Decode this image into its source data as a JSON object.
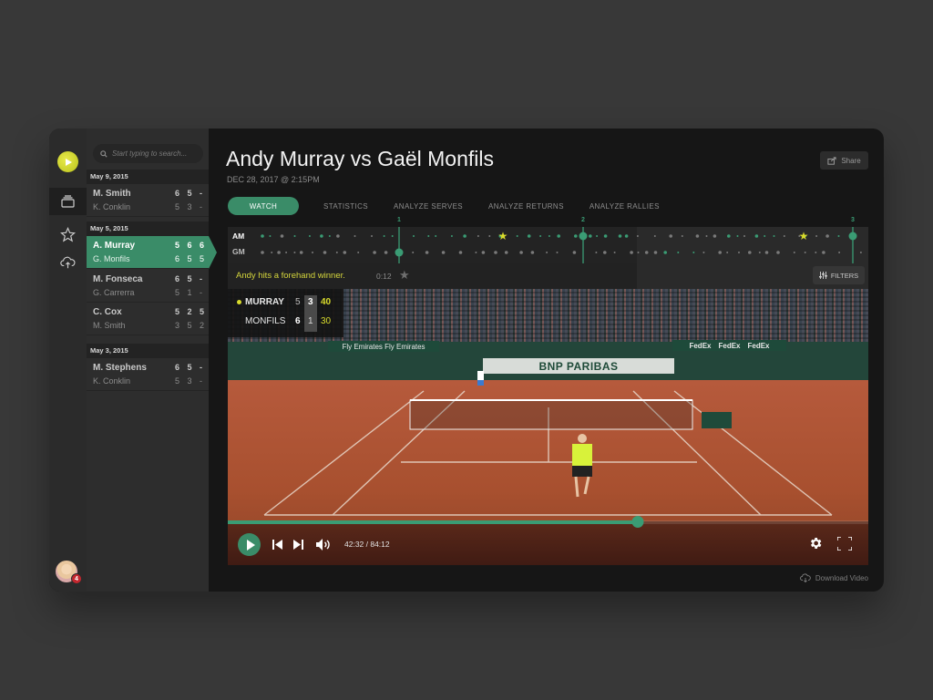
{
  "rail": {
    "items": [
      {
        "icon": "library-icon",
        "active": true
      },
      {
        "icon": "star-icon",
        "active": false
      },
      {
        "icon": "cloud-upload-icon",
        "active": false
      }
    ],
    "notification_count": "4"
  },
  "list": {
    "search_placeholder": "Start typing to search...",
    "groups": [
      {
        "date": "May 9, 2015",
        "matches": [
          {
            "p1": "M. Smith",
            "p2": "K. Conklin",
            "s1": "6 5 -",
            "s2": "5 3 -",
            "selected": false
          }
        ]
      },
      {
        "date": "May 5, 2015",
        "matches": [
          {
            "p1": "A. Murray",
            "p2": "G. Monfils",
            "s1": "5 6 6",
            "s2": "6 5 5",
            "selected": true
          },
          {
            "p1": "M. Fonseca",
            "p2": "G. Carrerra",
            "s1": "6 5 -",
            "s2": "5 1 -",
            "selected": false
          },
          {
            "p1": "C. Cox",
            "p2": "M. Smith",
            "s1": "5 2 5",
            "s2": "3 5 2",
            "selected": false
          }
        ]
      },
      {
        "date": "May 3, 2015",
        "matches": [
          {
            "p1": "M. Stephens",
            "p2": "K. Conklin",
            "s1": "6 5 -",
            "s2": "5 3 -",
            "selected": false
          }
        ]
      }
    ]
  },
  "header": {
    "title": "Andy Murray vs Gaël Monfils",
    "subtitle": "DEC 28, 2017 @ 2:15PM",
    "share_label": "Share"
  },
  "tabs": [
    {
      "label": "WATCH",
      "active": true
    },
    {
      "label": "STATISTICS",
      "active": false
    },
    {
      "label": "ANALYZE SERVES",
      "active": false
    },
    {
      "label": "ANALYZE RETURNS",
      "active": false
    },
    {
      "label": "ANALYZE RALLIES",
      "active": false
    }
  ],
  "timeline": {
    "rows": [
      "AM",
      "GM"
    ],
    "set_markers": [
      "1",
      "2",
      "3"
    ],
    "colors": {
      "accent": "#3a9c74",
      "highlight": "#d9dc2c",
      "muted": "#7a7a7a"
    }
  },
  "clip": {
    "caption": "Andy hits a forehand winner.",
    "time": "0:12",
    "filters_label": "FILTERS"
  },
  "scoreboard": {
    "players": [
      {
        "name": "MURRAY",
        "set1": "5",
        "set2": "3",
        "points": "40",
        "serving": true
      },
      {
        "name": "MONFILS",
        "set1": "6",
        "set2": "1",
        "points": "30",
        "serving": false
      }
    ]
  },
  "video": {
    "banners": {
      "center": "BNP PARIBAS",
      "left": "Fly Emirates  Fly Emirates",
      "right": [
        "FedEx",
        "FedEx",
        "FedEx"
      ]
    },
    "progress_fraction": 0.64,
    "time_display": "42:32 / 84:12"
  },
  "footer": {
    "download_label": "Download Video"
  }
}
